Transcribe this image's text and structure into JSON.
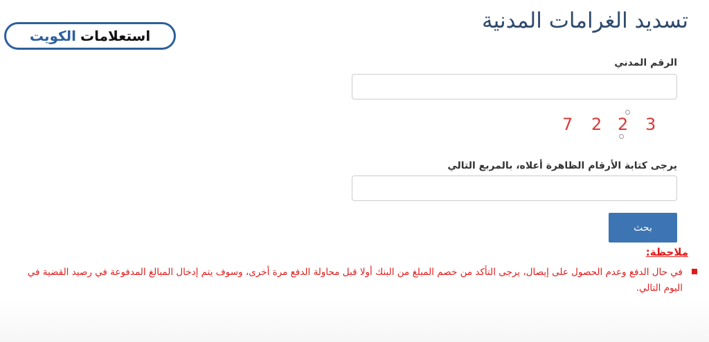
{
  "header": {
    "title": "تسديد الغرامات المدنية"
  },
  "logo": {
    "part1": "استعلامات",
    "part2": "الكويت"
  },
  "form": {
    "civil_id_label": "الرقم المدني",
    "civil_id_value": "",
    "captcha_digits": [
      "7",
      "2",
      "2",
      "3"
    ],
    "captcha_prompt_label": "يرجى كتابة الأرقام الظاهرة أعلاه، بالمربع التالي",
    "captcha_input_value": "",
    "search_button_label": "بحث"
  },
  "note": {
    "heading": "ملاحظة:",
    "text": "في حال الدفع وعدم الحصول على إيصال، يرجى التأكد من خصم المبلغ من البنك أولا قبل محاولة الدفع مرة أخرى، وسوف يتم إدخال المبالغ المدفوعة في رصيد القضية في اليوم التالي."
  },
  "colors": {
    "title": "#2e4a6c",
    "logo_accent": "#2d5f9c",
    "button": "#3d75b4",
    "note": "#e01b1b",
    "captcha": "#d93a3a"
  }
}
